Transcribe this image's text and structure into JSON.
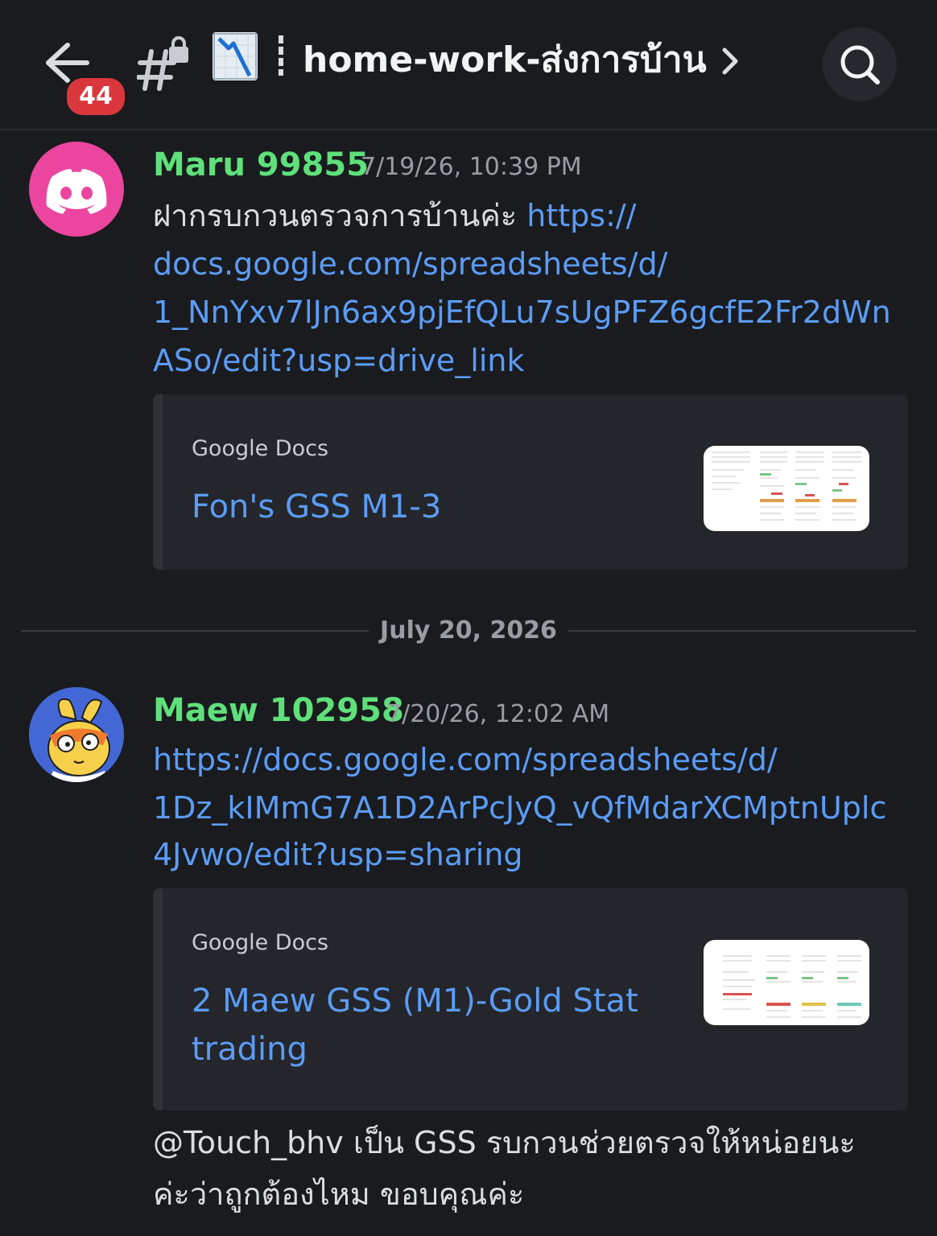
{
  "header": {
    "unread_count": "44",
    "channel_name": "home-work-ส่งการบ้าน"
  },
  "date_divider": "July 20, 2026",
  "messages": [
    {
      "author": "Maru 99855",
      "timestamp": "7/19/26, 10:39 PM",
      "text_prefix": "ฝากรบกวนตรวจการบ้านค่ะ ",
      "link_lines": [
        "https://",
        "docs.google.com/spreadsheets/d/",
        "1_NnYxv7lJn6ax9pjEfQLu7sUgPFZ6gcfE2Fr2dWn",
        "ASo/edit?usp=drive_link"
      ],
      "embed": {
        "provider": "Google Docs",
        "title": "Fon's GSS M1-3"
      }
    },
    {
      "author": "Maew 102958",
      "timestamp": "7/20/26, 12:02 AM",
      "link_lines": [
        "https://docs.google.com/spreadsheets/d/",
        "1Dz_kIMmG7A1D2ArPcJyQ_vQfMdarXCMptnUplc",
        "4Jvwo/edit?usp=sharing"
      ],
      "embed": {
        "provider": "Google Docs",
        "title_lines": [
          "2 Maew GSS (M1)-Gold Stat",
          "trading"
        ]
      },
      "followup_lines": [
        "@Touch_bhv เป็น GSS  รบกวนช่วยตรวจให้หน่อยนะ",
        "ค่ะว่าถูกต้องไหม  ขอบคุณค่ะ"
      ]
    }
  ],
  "colors": {
    "background": "#1a1b1f",
    "author_name": "#5ee07a",
    "link": "#5b9cf5",
    "badge": "#da373c",
    "discord_avatar": "#eb459f"
  }
}
